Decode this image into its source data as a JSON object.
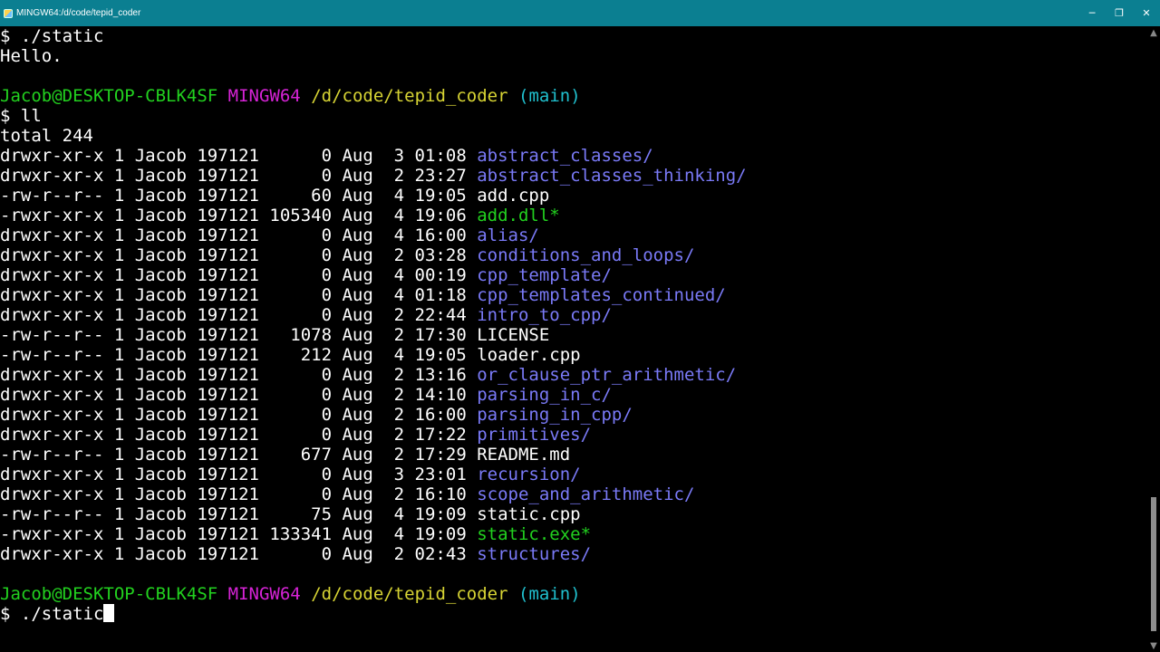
{
  "window": {
    "title": "MINGW64:/d/code/tepid_coder",
    "minimize": "─",
    "maximize": "❐",
    "close": "✕"
  },
  "terminal": {
    "first_cmd": "$ ./static",
    "hello_output": "Hello.",
    "prompt_user": "Jacob@DESKTOP-CBLK4SF",
    "prompt_env": "MINGW64",
    "prompt_path": "/d/code/tepid_coder",
    "prompt_branch": "(main)",
    "ll_cmd": "$ ll",
    "total_line": "total 244",
    "listing": [
      {
        "perms": "drwxr-xr-x",
        "links": "1",
        "owner": "Jacob",
        "group": "197121",
        "size": "0",
        "month": "Aug",
        "day": "3",
        "time": "01:08",
        "name": "abstract_classes/",
        "type": "dir"
      },
      {
        "perms": "drwxr-xr-x",
        "links": "1",
        "owner": "Jacob",
        "group": "197121",
        "size": "0",
        "month": "Aug",
        "day": "2",
        "time": "23:27",
        "name": "abstract_classes_thinking/",
        "type": "dir"
      },
      {
        "perms": "-rw-r--r--",
        "links": "1",
        "owner": "Jacob",
        "group": "197121",
        "size": "60",
        "month": "Aug",
        "day": "4",
        "time": "19:05",
        "name": "add.cpp",
        "type": "file"
      },
      {
        "perms": "-rwxr-xr-x",
        "links": "1",
        "owner": "Jacob",
        "group": "197121",
        "size": "105340",
        "month": "Aug",
        "day": "4",
        "time": "19:06",
        "name": "add.dll*",
        "type": "exe"
      },
      {
        "perms": "drwxr-xr-x",
        "links": "1",
        "owner": "Jacob",
        "group": "197121",
        "size": "0",
        "month": "Aug",
        "day": "4",
        "time": "16:00",
        "name": "alias/",
        "type": "dir"
      },
      {
        "perms": "drwxr-xr-x",
        "links": "1",
        "owner": "Jacob",
        "group": "197121",
        "size": "0",
        "month": "Aug",
        "day": "2",
        "time": "03:28",
        "name": "conditions_and_loops/",
        "type": "dir"
      },
      {
        "perms": "drwxr-xr-x",
        "links": "1",
        "owner": "Jacob",
        "group": "197121",
        "size": "0",
        "month": "Aug",
        "day": "4",
        "time": "00:19",
        "name": "cpp_template/",
        "type": "dir"
      },
      {
        "perms": "drwxr-xr-x",
        "links": "1",
        "owner": "Jacob",
        "group": "197121",
        "size": "0",
        "month": "Aug",
        "day": "4",
        "time": "01:18",
        "name": "cpp_templates_continued/",
        "type": "dir"
      },
      {
        "perms": "drwxr-xr-x",
        "links": "1",
        "owner": "Jacob",
        "group": "197121",
        "size": "0",
        "month": "Aug",
        "day": "2",
        "time": "22:44",
        "name": "intro_to_cpp/",
        "type": "dir"
      },
      {
        "perms": "-rw-r--r--",
        "links": "1",
        "owner": "Jacob",
        "group": "197121",
        "size": "1078",
        "month": "Aug",
        "day": "2",
        "time": "17:30",
        "name": "LICENSE",
        "type": "file"
      },
      {
        "perms": "-rw-r--r--",
        "links": "1",
        "owner": "Jacob",
        "group": "197121",
        "size": "212",
        "month": "Aug",
        "day": "4",
        "time": "19:05",
        "name": "loader.cpp",
        "type": "file"
      },
      {
        "perms": "drwxr-xr-x",
        "links": "1",
        "owner": "Jacob",
        "group": "197121",
        "size": "0",
        "month": "Aug",
        "day": "2",
        "time": "13:16",
        "name": "or_clause_ptr_arithmetic/",
        "type": "dir"
      },
      {
        "perms": "drwxr-xr-x",
        "links": "1",
        "owner": "Jacob",
        "group": "197121",
        "size": "0",
        "month": "Aug",
        "day": "2",
        "time": "14:10",
        "name": "parsing_in_c/",
        "type": "dir"
      },
      {
        "perms": "drwxr-xr-x",
        "links": "1",
        "owner": "Jacob",
        "group": "197121",
        "size": "0",
        "month": "Aug",
        "day": "2",
        "time": "16:00",
        "name": "parsing_in_cpp/",
        "type": "dir"
      },
      {
        "perms": "drwxr-xr-x",
        "links": "1",
        "owner": "Jacob",
        "group": "197121",
        "size": "0",
        "month": "Aug",
        "day": "2",
        "time": "17:22",
        "name": "primitives/",
        "type": "dir"
      },
      {
        "perms": "-rw-r--r--",
        "links": "1",
        "owner": "Jacob",
        "group": "197121",
        "size": "677",
        "month": "Aug",
        "day": "2",
        "time": "17:29",
        "name": "README.md",
        "type": "file"
      },
      {
        "perms": "drwxr-xr-x",
        "links": "1",
        "owner": "Jacob",
        "group": "197121",
        "size": "0",
        "month": "Aug",
        "day": "3",
        "time": "23:01",
        "name": "recursion/",
        "type": "dir"
      },
      {
        "perms": "drwxr-xr-x",
        "links": "1",
        "owner": "Jacob",
        "group": "197121",
        "size": "0",
        "month": "Aug",
        "day": "2",
        "time": "16:10",
        "name": "scope_and_arithmetic/",
        "type": "dir"
      },
      {
        "perms": "-rw-r--r--",
        "links": "1",
        "owner": "Jacob",
        "group": "197121",
        "size": "75",
        "month": "Aug",
        "day": "4",
        "time": "19:09",
        "name": "static.cpp",
        "type": "file"
      },
      {
        "perms": "-rwxr-xr-x",
        "links": "1",
        "owner": "Jacob",
        "group": "197121",
        "size": "133341",
        "month": "Aug",
        "day": "4",
        "time": "19:09",
        "name": "static.exe*",
        "type": "exe"
      },
      {
        "perms": "drwxr-xr-x",
        "links": "1",
        "owner": "Jacob",
        "group": "197121",
        "size": "0",
        "month": "Aug",
        "day": "2",
        "time": "02:43",
        "name": "structures/",
        "type": "dir"
      }
    ],
    "current_input": "$ ./static"
  },
  "colors": {
    "titlebar": "#0b7f91",
    "prompt_user": "#22d11f",
    "prompt_env": "#d623d6",
    "prompt_path": "#d7d434",
    "prompt_branch": "#20c1cf",
    "directory": "#7a7af7",
    "executable": "#22d11f"
  }
}
